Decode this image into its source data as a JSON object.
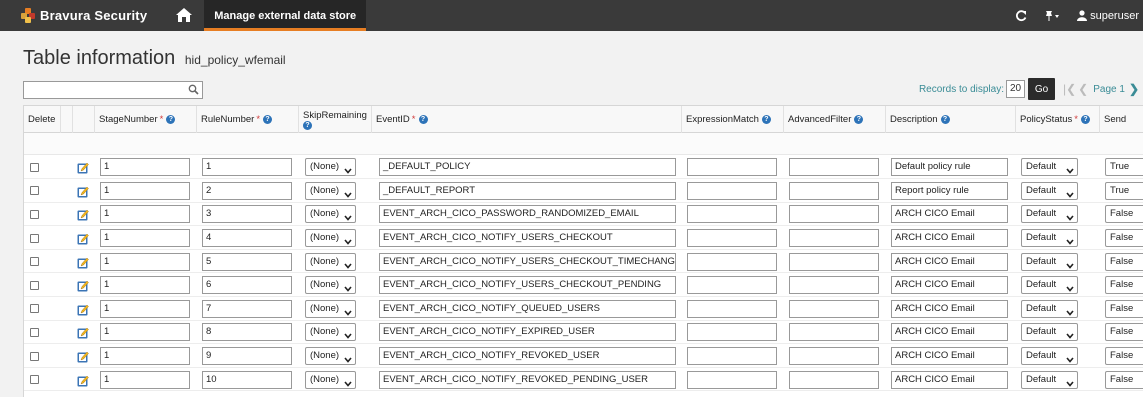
{
  "header": {
    "brand": "Bravura Security",
    "active_tab": "Manage external data store",
    "user": "superuser"
  },
  "page": {
    "title": "Table information",
    "subtitle": "hid_policy_wfemail"
  },
  "search": {
    "value": ""
  },
  "pager": {
    "records_label": "Records to display:",
    "records_value": "20",
    "go_label": "Go",
    "page_label": "Page 1"
  },
  "columns": {
    "delete": "Delete",
    "stage": "StageNumber",
    "rule": "RuleNumber",
    "skip": "SkipRemaining",
    "event": "EventID",
    "expr": "ExpressionMatch",
    "adv": "AdvancedFilter",
    "desc": "Description",
    "status": "PolicyStatus",
    "send": "Send"
  },
  "rows": [
    {
      "stage": "1",
      "rule": "1",
      "skip": "(None)",
      "event": "_DEFAULT_POLICY",
      "expr": "",
      "adv": "",
      "desc": "Default policy rule",
      "status": "Default",
      "send": "True"
    },
    {
      "stage": "1",
      "rule": "2",
      "skip": "(None)",
      "event": "_DEFAULT_REPORT",
      "expr": "",
      "adv": "",
      "desc": "Report policy rule",
      "status": "Default",
      "send": "True"
    },
    {
      "stage": "1",
      "rule": "3",
      "skip": "(None)",
      "event": "EVENT_ARCH_CICO_PASSWORD_RANDOMIZED_EMAIL",
      "expr": "",
      "adv": "",
      "desc": "ARCH CICO Email",
      "status": "Default",
      "send": "False"
    },
    {
      "stage": "1",
      "rule": "4",
      "skip": "(None)",
      "event": "EVENT_ARCH_CICO_NOTIFY_USERS_CHECKOUT",
      "expr": "",
      "adv": "",
      "desc": "ARCH CICO Email",
      "status": "Default",
      "send": "False"
    },
    {
      "stage": "1",
      "rule": "5",
      "skip": "(None)",
      "event": "EVENT_ARCH_CICO_NOTIFY_USERS_CHECKOUT_TIMECHANGE",
      "expr": "",
      "adv": "",
      "desc": "ARCH CICO Email",
      "status": "Default",
      "send": "False"
    },
    {
      "stage": "1",
      "rule": "6",
      "skip": "(None)",
      "event": "EVENT_ARCH_CICO_NOTIFY_USERS_CHECKOUT_PENDING",
      "expr": "",
      "adv": "",
      "desc": "ARCH CICO Email",
      "status": "Default",
      "send": "False"
    },
    {
      "stage": "1",
      "rule": "7",
      "skip": "(None)",
      "event": "EVENT_ARCH_CICO_NOTIFY_QUEUED_USERS",
      "expr": "",
      "adv": "",
      "desc": "ARCH CICO Email",
      "status": "Default",
      "send": "False"
    },
    {
      "stage": "1",
      "rule": "8",
      "skip": "(None)",
      "event": "EVENT_ARCH_CICO_NOTIFY_EXPIRED_USER",
      "expr": "",
      "adv": "",
      "desc": "ARCH CICO Email",
      "status": "Default",
      "send": "False"
    },
    {
      "stage": "1",
      "rule": "9",
      "skip": "(None)",
      "event": "EVENT_ARCH_CICO_NOTIFY_REVOKED_USER",
      "expr": "",
      "adv": "",
      "desc": "ARCH CICO Email",
      "status": "Default",
      "send": "False"
    },
    {
      "stage": "1",
      "rule": "10",
      "skip": "(None)",
      "event": "EVENT_ARCH_CICO_NOTIFY_REVOKED_PENDING_USER",
      "expr": "",
      "adv": "",
      "desc": "ARCH CICO Email",
      "status": "Default",
      "send": "False"
    }
  ]
}
